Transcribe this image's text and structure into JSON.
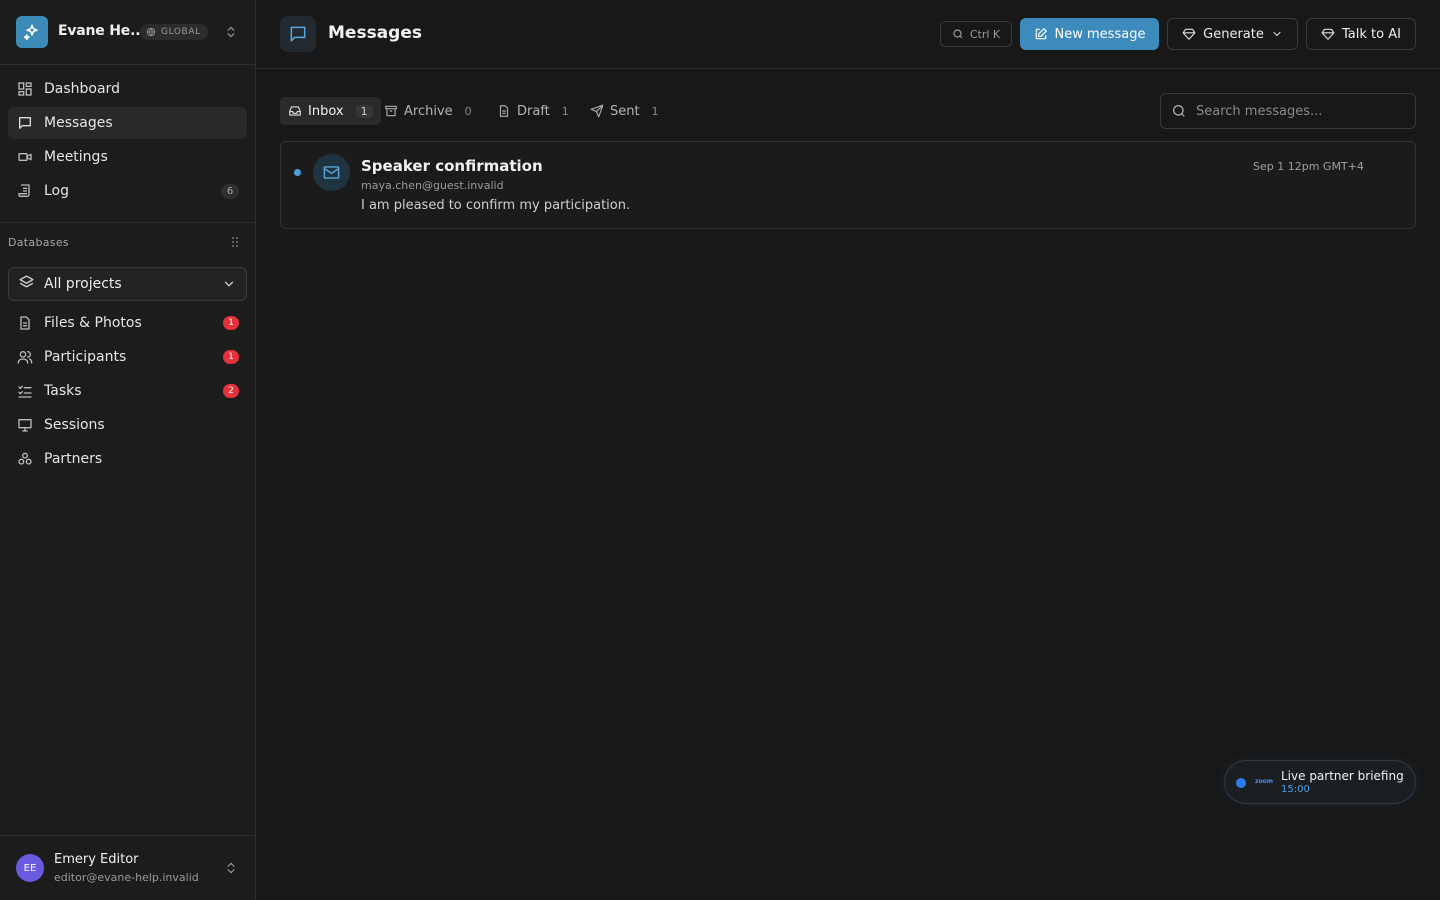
{
  "workspace": {
    "name": "Evane He...",
    "badge": "GLOBAL"
  },
  "nav": [
    {
      "label": "Dashboard",
      "icon": "dashboard-icon"
    },
    {
      "label": "Messages",
      "icon": "message-icon",
      "active": true
    },
    {
      "label": "Meetings",
      "icon": "video-icon"
    },
    {
      "label": "Log",
      "icon": "log-icon",
      "count": "6"
    }
  ],
  "databases": {
    "title": "Databases",
    "project_select": "All projects",
    "items": [
      {
        "label": "Files & Photos",
        "icon": "file-icon",
        "badge": "1"
      },
      {
        "label": "Participants",
        "icon": "users-icon",
        "badge": "1"
      },
      {
        "label": "Tasks",
        "icon": "tasks-icon",
        "badge": "2"
      },
      {
        "label": "Sessions",
        "icon": "presentation-icon"
      },
      {
        "label": "Partners",
        "icon": "partners-icon"
      }
    ]
  },
  "user": {
    "initials": "EE",
    "name": "Emery Editor",
    "email": "editor@evane-help.invalid"
  },
  "header": {
    "title": "Messages",
    "shortcut": "Ctrl K",
    "new_message": "New message",
    "generate": "Generate",
    "talk_ai": "Talk to AI"
  },
  "tabs": [
    {
      "label": "Inbox",
      "count": "1"
    },
    {
      "label": "Archive",
      "count": "0"
    },
    {
      "label": "Draft",
      "count": "1"
    },
    {
      "label": "Sent",
      "count": "1"
    }
  ],
  "search": {
    "placeholder": "Search messages..."
  },
  "messages": [
    {
      "subject": "Speaker confirmation",
      "from": "maya.chen@guest.invalid",
      "preview": "I am pleased to confirm my participation.",
      "date": "Sep 1 12pm GMT+4"
    }
  ],
  "live": {
    "brand": "zoom",
    "title": "Live partner briefing",
    "time": "15:00"
  },
  "colors": {
    "accent": "#3d8bbd",
    "badge_red": "#e5323a",
    "background": "#181818"
  }
}
